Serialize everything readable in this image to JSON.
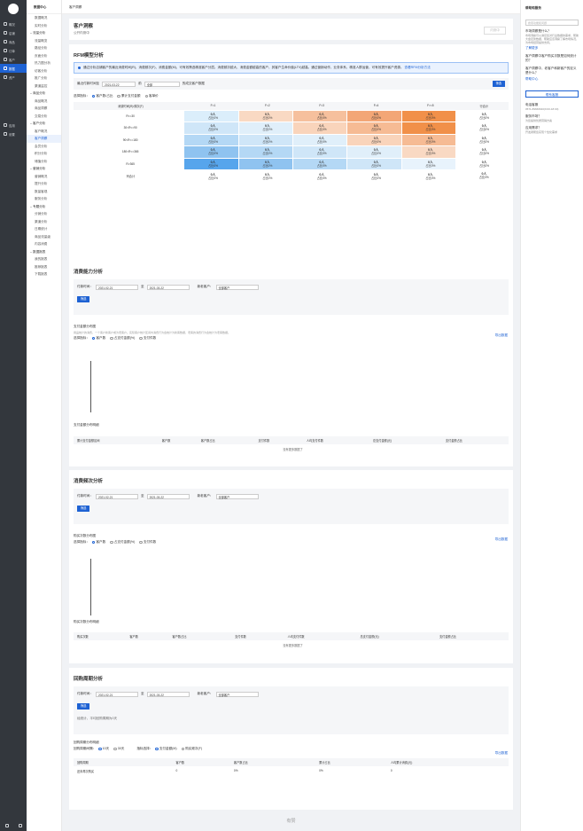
{
  "nav1": {
    "items": [
      "概况",
      "店铺",
      "商品",
      "订单",
      "客户",
      "数据",
      "资产"
    ],
    "bottom_items": [
      "应用",
      "设置"
    ]
  },
  "nav2": {
    "header": "数据中心",
    "entries": [
      {
        "type": "sub",
        "label": "数据概况"
      },
      {
        "type": "sub",
        "label": "实时分析"
      },
      {
        "type": "sec",
        "label": "流量分析"
      },
      {
        "type": "sub",
        "label": "流量概览"
      },
      {
        "type": "sub",
        "label": "路径分析"
      },
      {
        "type": "sub",
        "label": "页面分析"
      },
      {
        "type": "sub",
        "label": "热力图分析"
      },
      {
        "type": "sub",
        "label": "访客分析"
      },
      {
        "type": "sub",
        "label": "推广分析"
      },
      {
        "type": "sub",
        "label": "渠道监控"
      },
      {
        "type": "sec",
        "label": "商品分析"
      },
      {
        "type": "sub",
        "label": "商品概况"
      },
      {
        "type": "sub",
        "label": "商品洞察"
      },
      {
        "type": "sub",
        "label": "交易分析"
      },
      {
        "type": "sec",
        "label": "客户分析"
      },
      {
        "type": "sub",
        "label": "客户概况"
      },
      {
        "type": "sub",
        "label": "客户洞察",
        "active": true
      },
      {
        "type": "sub",
        "label": "会员分析"
      },
      {
        "type": "sub",
        "label": "积分分析"
      },
      {
        "type": "sub",
        "label": "储值分析"
      },
      {
        "type": "sec",
        "label": "营销分析"
      },
      {
        "type": "sub",
        "label": "营销概况"
      },
      {
        "type": "sub",
        "label": "提升分析"
      },
      {
        "type": "sub",
        "label": "数量客观"
      },
      {
        "type": "sub",
        "label": "服务分析"
      },
      {
        "type": "sec",
        "label": "专题分析"
      },
      {
        "type": "sub",
        "label": "分销分析"
      },
      {
        "type": "sub",
        "label": "渠道分析"
      },
      {
        "type": "sub",
        "label": "日期统计"
      },
      {
        "type": "sub",
        "label": "商品流量级"
      },
      {
        "type": "sub",
        "label": "内容消费"
      },
      {
        "type": "sec",
        "label": "数据报表"
      },
      {
        "type": "sub",
        "label": "我的报表"
      },
      {
        "type": "sub",
        "label": "推荐报表"
      },
      {
        "type": "sub",
        "label": "下载报表"
      }
    ]
  },
  "topbar": {
    "breadcrumb": "客户洞察"
  },
  "header": {
    "title": "客户洞察",
    "subtitle": "公开内测中",
    "button": "内测中"
  },
  "rfm": {
    "title": "RFM模型分析",
    "info": "通过分析店铺客户的最近消费时间(R)、消费频次(F)、消费金额(M)，可有效筛选精准客户分层。消费频次越大、消费金额越高的客户，其客户生命价值(LTV)越高。通过营销动作，业务体系，精准人群运营，可有效提升客户资源。",
    "info_link": "查看RFM分析方法",
    "filter_label": "最近付款时间至",
    "date": "2021-03-22",
    "preset_label": "前",
    "preset_value": "全部",
    "suffix": "的成交客户数据",
    "filter_button": "筛选",
    "metric_label": "选择指标：",
    "metrics": [
      "客户数/占比",
      "累计支付金额",
      "客单价"
    ],
    "corner": "消费时间(R)/频次(F)",
    "cols": [
      "F=1",
      "F=2",
      "F=3",
      "F=4",
      "F>=5",
      "行合计"
    ],
    "rows": [
      "R<=30",
      "30<R<=90",
      "90<R<=180",
      "180<R<=365",
      "R>365",
      "列合计"
    ],
    "cell_value": "0人",
    "cell_ratio": "占比0%"
  },
  "ability": {
    "title": "消费能力分析",
    "pay_label": "付款时间：",
    "start": "2021-02-21",
    "sep": "至",
    "end": "2021-03-22",
    "new_label": "新老客户：",
    "new_value": "全部客户",
    "filter_button": "筛选",
    "dist_title": "支付金额分布图",
    "dist_desc": "用品统计的消费，一个客户新客户或为老客户。实际客户统计区间内消费行为会统计为新客数据，老客的消费行为会统计为老客数据。",
    "export": "导出数据",
    "metric_label": "选择指标：",
    "metrics": [
      "客户数",
      "占支付金额(%)",
      "支付件数"
    ],
    "table_title": "支付金额分布明细",
    "cols": [
      "累计支付金额区间",
      "客户数",
      "客户数占比",
      "支付件数",
      "人均支付件数",
      "总支付金额(元)",
      "支付金额占比"
    ],
    "empty": "没有更多数据了"
  },
  "frequency": {
    "title": "消费频次分析",
    "pay_label": "付款时间：",
    "start": "2021-02-21",
    "sep": "至",
    "end": "2021-03-22",
    "new_label": "新老客户：",
    "new_value": "全部客户",
    "filter_button": "筛选",
    "dist_title": "购买次数分布图",
    "export": "导出数据",
    "metric_label": "选择指标：",
    "metrics": [
      "客户数",
      "占支付金额(%)",
      "支付件数"
    ],
    "table_title": "购买次数分布明细",
    "cols": [
      "购买次数",
      "客户数",
      "客户数占比",
      "支付件数",
      "人均支付件数",
      "总支付金额(元)",
      "支付金额占比"
    ],
    "empty": "没有更多数据了"
  },
  "repurchase": {
    "title": "回购周期分析",
    "pay_label": "付款时间：",
    "start": "2021-02-21",
    "sep": "至",
    "end": "2021-03-22",
    "new_label": "新老客户：",
    "new_value": "全部客户",
    "filter_button": "筛选",
    "summary": "经统计，平均回购周期为0天",
    "table_title": "回购周期分布明细",
    "export": "导出数据",
    "period_label": "回购周期间隔：",
    "periods": [
      "10天",
      "30天"
    ],
    "metric_label": "指标选择：",
    "metrics": [
      "支付金额(M)",
      "购买频次(F)"
    ],
    "cols": [
      "回购周期",
      "客户数",
      "客户数占比",
      "累计占比",
      "人均累计消费(元)"
    ],
    "row": [
      "还未再次购买",
      "0",
      "0%",
      "0%",
      "0"
    ]
  },
  "right": {
    "title": "帮助和服务",
    "search": "搜索功能和问题",
    "faq": [
      {
        "q": "市场洞察是什么？",
        "a": "市场洞察可以满足您对行业数据的需求，帮助大盘走势数据，帮助应该洞察了解市场情况，为市场经营提供支持。",
        "link": "了解更多"
      },
      {
        "q": "客户洞察中客户购买次数是如何统计的？",
        "a": "",
        "link": ""
      },
      {
        "q": "客户洞察中，老客户和新客户的定义是什么？",
        "a": "",
        "link": "帮助中心"
      }
    ],
    "contact": "联系客服",
    "phone_label": "电话客服",
    "phone": "0571-89666640(9:00-18:00)",
    "tips": [
      {
        "q": "服务市场？",
        "a": "为您提供优质营销方案"
      },
      {
        "q": "应用需求？",
        "a": "开发者帮您实现个性化需求"
      }
    ]
  },
  "footer": "有赞"
}
